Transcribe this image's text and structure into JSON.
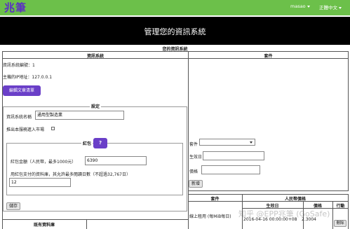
{
  "header": {
    "logo": "兆筆",
    "user": "masao",
    "language": "正體中文"
  },
  "banner": {
    "title": "管理您的資訊系統"
  },
  "page": {
    "content_title": "您的資訊系統"
  },
  "info_panel": {
    "title": "資訊系統",
    "system_id": "資訊系統編號：1",
    "host_ip": "主機的IP地址：127.0.0.1",
    "edit_button": "編輯文章清單"
  },
  "settings": {
    "title": "設定",
    "name_label": "資訊系統名稱",
    "name_value": "通用型製造業",
    "market_label": "推出本服務進入市場",
    "red_packet": {
      "title": "紅包",
      "help_button": "?",
      "amount_label": "紅包金額（人民幣，最多1000元）",
      "amount_value": "6390",
      "pages_label": "用紅包支付的資料庫，其允許最多閱讀日數（不超過32,767日）",
      "pages_value": "12"
    },
    "save_button": "儲存"
  },
  "existing": {
    "title": "既有資料庫"
  },
  "plugins": {
    "title": "套件",
    "plugin_label": "套件",
    "effective_label": "生效日",
    "price_label": "價格",
    "add_button": "新增"
  },
  "price_table": {
    "col_plugin": "套件",
    "col_rmb": "人民幣價格",
    "sub_effective": "生效日",
    "sub_price": "價格",
    "sub_action": "行動",
    "row_plugin": "線上租用 (每MiB每日)",
    "row_date": "2016-04-16 00:00:00+08",
    "row_price": "2.3004",
    "row_action": "刪除"
  },
  "watermark": "知乎 @EPP兆筆 (GoSafe)"
}
